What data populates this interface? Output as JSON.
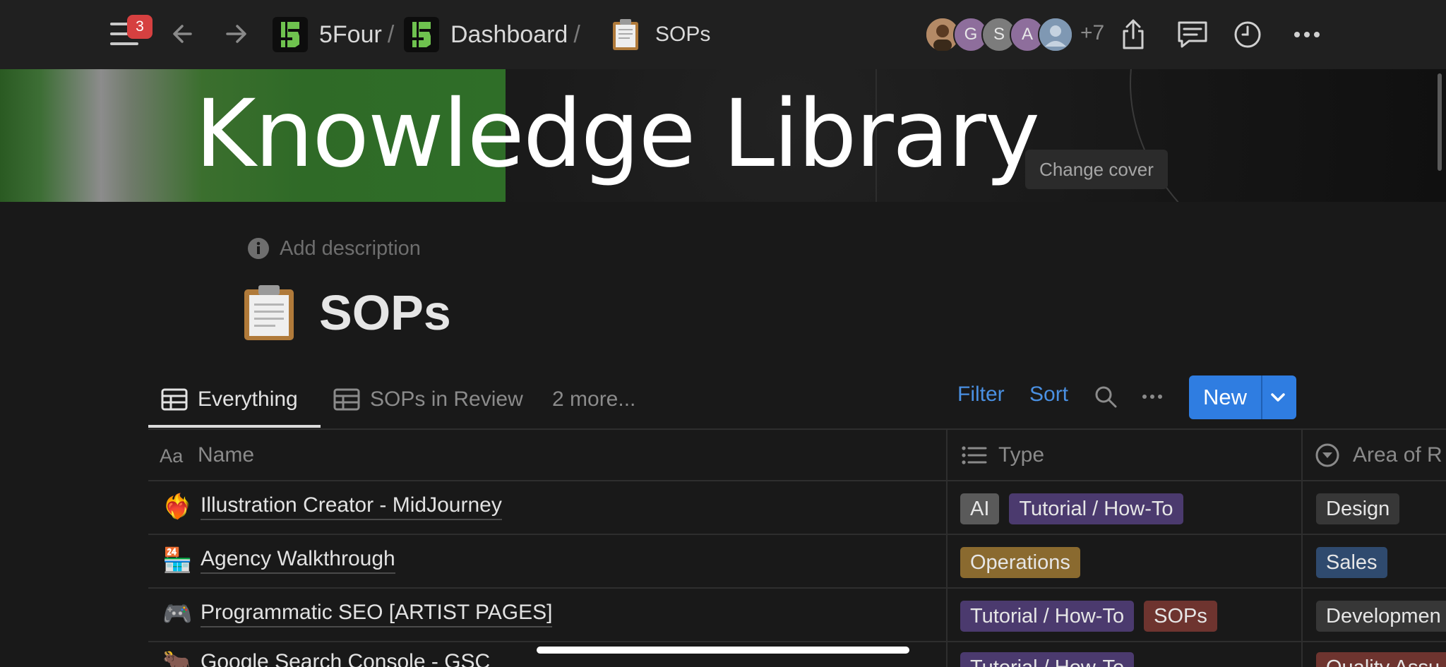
{
  "topbar": {
    "notification_count": "3",
    "breadcrumbs": [
      {
        "label": "5Four"
      },
      {
        "label": "Dashboard"
      },
      {
        "label": "SOPs"
      }
    ],
    "separator": "/",
    "avatars": [
      {
        "initial": "",
        "color": "#a07a5a"
      },
      {
        "initial": "G",
        "color": "#8e6e9c"
      },
      {
        "initial": "S",
        "color": "#7c7c7c"
      },
      {
        "initial": "A",
        "color": "#8e6e9c"
      },
      {
        "initial": "",
        "color": "#7f98b3"
      }
    ],
    "extra_members": "+7"
  },
  "cover": {
    "title": "Knowledge Library",
    "change_cover_label": "Change cover"
  },
  "page": {
    "add_description_placeholder": "Add description",
    "title": "SOPs"
  },
  "views": {
    "tabs": [
      {
        "label": "Everything",
        "active": true
      },
      {
        "label": "SOPs in Review",
        "active": false
      }
    ],
    "more_label": "2 more...",
    "filter_label": "Filter",
    "sort_label": "Sort",
    "new_label": "New"
  },
  "table": {
    "columns": [
      {
        "label": "Name",
        "icon": "text-aa-icon"
      },
      {
        "label": "Type",
        "icon": "list-icon"
      },
      {
        "label": "Area of R",
        "icon": "select-circle-icon"
      }
    ],
    "rows": [
      {
        "emoji": "❤️‍🔥",
        "name": "Illustration Creator - MidJourney",
        "types": [
          {
            "label": "AI",
            "color": "#5a5a5a"
          },
          {
            "label": "Tutorial / How-To",
            "color": "#4b3a6e"
          }
        ],
        "areas": [
          {
            "label": "Design",
            "color": "#373737"
          }
        ]
      },
      {
        "emoji": "🏪",
        "name": "Agency Walkthrough",
        "types": [
          {
            "label": "Operations",
            "color": "#8a6a2f"
          }
        ],
        "areas": [
          {
            "label": "Sales",
            "color": "#2f4a6e"
          }
        ]
      },
      {
        "emoji": "🎮",
        "name": "Programmatic SEO [ARTIST PAGES]",
        "types": [
          {
            "label": "Tutorial / How-To",
            "color": "#4b3a6e"
          },
          {
            "label": "SOPs",
            "color": "#6e342f"
          }
        ],
        "areas": [
          {
            "label": "Developmen",
            "color": "#373737"
          }
        ]
      },
      {
        "emoji": "🐂",
        "name": "Google Search Console - GSC",
        "types": [
          {
            "label": "Tutorial / How-To",
            "color": "#4b3a6e"
          }
        ],
        "areas": [
          {
            "label": "Quality Assu",
            "color": "#6e342f"
          }
        ]
      }
    ]
  }
}
